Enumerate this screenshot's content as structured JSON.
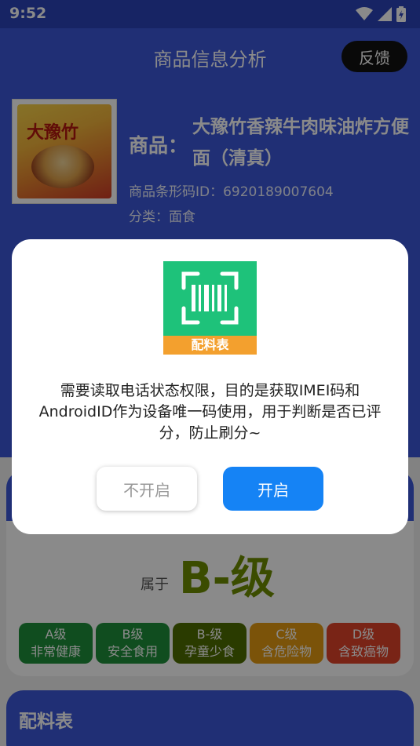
{
  "status_bar": {
    "time": "9:52",
    "icons": [
      "wifi-icon",
      "signal-icon",
      "battery-charging-icon"
    ]
  },
  "header": {
    "title": "商品信息分析",
    "feedback_label": "反馈"
  },
  "product": {
    "image_text": "大豫竹",
    "label": "商品：",
    "name": "大豫竹香辣牛肉味油炸方便面（清真）",
    "barcode": "商品条形码ID：6920189007604",
    "category": "分类：面食"
  },
  "grade_section": {
    "belongs_label": "属于",
    "grade": "B-级",
    "levels": [
      {
        "level": "A级",
        "desc": "非常健康",
        "color": "#1f8f3a"
      },
      {
        "level": "B级",
        "desc": "安全食用",
        "color": "#1f8f3a"
      },
      {
        "level": "B-级",
        "desc": "孕童少食",
        "color": "#4e6d00"
      },
      {
        "level": "C级",
        "desc": "含危险物",
        "color": "#e39a12"
      },
      {
        "level": "D级",
        "desc": "含致癌物",
        "color": "#e0442a"
      }
    ]
  },
  "ingredients": {
    "title": "配料表"
  },
  "dialog": {
    "logo_label": "配料表",
    "message": "需要读取电话状态权限，目的是获取IMEI码和AndroidID作为设备唯一码使用，用于判断是否已评分，防止刷分~",
    "deny_label": "不开启",
    "allow_label": "开启"
  },
  "colors": {
    "primary": "#3b57d8",
    "allow_button": "#1583f5",
    "logo_green": "#1ec27a",
    "logo_orange": "#f3a02e"
  }
}
